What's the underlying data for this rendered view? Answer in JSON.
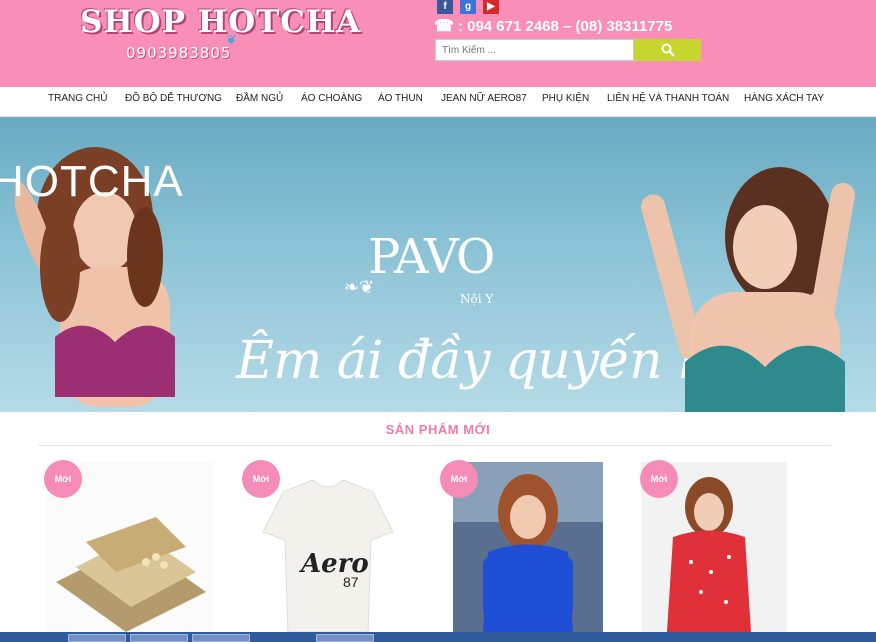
{
  "header": {
    "logo_text": "SHOP HOTCHA",
    "logo_phone": "0903983805",
    "hotline": ": 094 671 2468 – (08) 38311775",
    "search_placeholder": "Tìm Kiếm ...",
    "social": [
      "f",
      "g",
      "▶"
    ]
  },
  "nav": {
    "items": [
      "TRANG CHỦ",
      "ĐỒ BỘ DỄ THƯƠNG",
      "ĐẦM NGỦ",
      "ÁO CHOÀNG",
      "ÁO THUN",
      "JEAN NỮ AERO87",
      "PHỤ KIỆN",
      "LIÊN HỆ VÀ THANH TOÁN",
      "HÀNG XÁCH TAY"
    ]
  },
  "banner": {
    "watermark": "HOTCHA",
    "brand": "PAVO",
    "brand_sub": "Nội Y",
    "slogan": "Êm ái đầy quyến rũ"
  },
  "section": {
    "title": "SẢN PHẨM MỚI"
  },
  "products": [
    {
      "badge": "Mới",
      "image": "gold-wallet"
    },
    {
      "badge": "Mới",
      "image": "aero87-tshirt"
    },
    {
      "badge": "Mới",
      "image": "blue-sweater-model"
    },
    {
      "badge": "Mới",
      "image": "red-polka-pajama-model"
    }
  ],
  "colors": {
    "header_pink": "#f98fb9",
    "badge_pink": "#f48cb7",
    "search_button": "#c6d62f",
    "banner_blue": "#7fb9cf"
  }
}
